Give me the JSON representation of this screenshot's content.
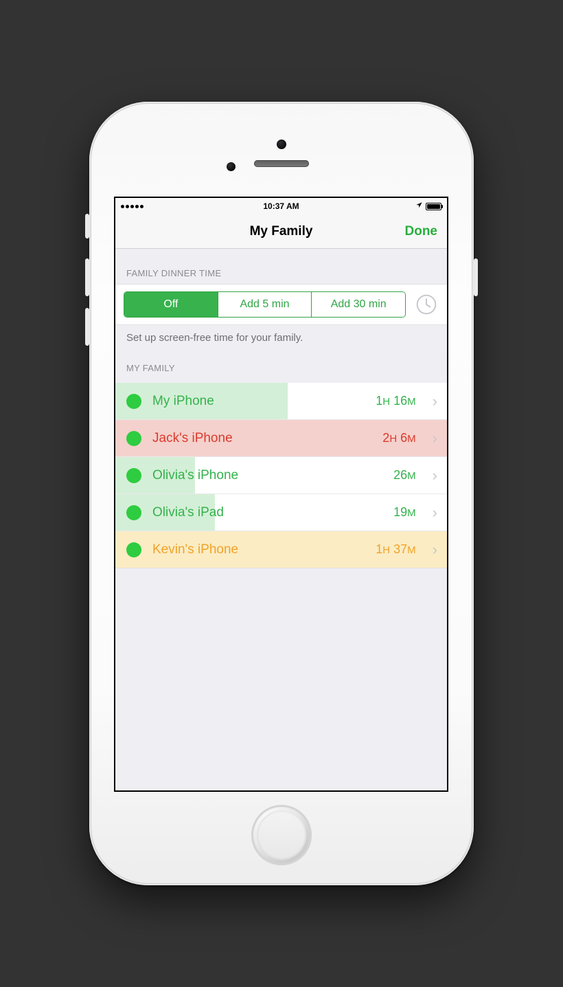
{
  "statusbar": {
    "time": "10:37 AM"
  },
  "nav": {
    "title": "My Family",
    "done": "Done"
  },
  "dinner": {
    "header": "FAMILY DINNER TIME",
    "options": [
      "Off",
      "Add 5 min",
      "Add 30 min"
    ],
    "selected_index": 0,
    "footer": "Set up screen-free time for your family."
  },
  "family": {
    "header": "MY FAMILY",
    "devices": [
      {
        "name": "My iPhone",
        "time": "1H 16M",
        "fill_pct": 52,
        "fill_color": "#d4efd7",
        "text_color": "#34b24c",
        "time_color": "#34b24c",
        "dot_color": "#2ecc40"
      },
      {
        "name": "Jack's iPhone",
        "time": "2H 6M",
        "fill_pct": 100,
        "fill_color": "#f4d1cc",
        "text_color": "#dc3a2d",
        "time_color": "#dc3a2d",
        "dot_color": "#2ecc40"
      },
      {
        "name": "Olivia's iPhone",
        "time": "26M",
        "fill_pct": 24,
        "fill_color": "#d4efd7",
        "text_color": "#34b24c",
        "time_color": "#34b24c",
        "dot_color": "#2ecc40"
      },
      {
        "name": "Olivia's iPad",
        "time": "19M",
        "fill_pct": 30,
        "fill_color": "#d4efd7",
        "text_color": "#34b24c",
        "time_color": "#34b24c",
        "dot_color": "#2ecc40"
      },
      {
        "name": "Kevin's iPhone",
        "time": "1H 37M",
        "fill_pct": 100,
        "fill_color": "#fbecc3",
        "text_color": "#f0a32a",
        "time_color": "#f0a32a",
        "dot_color": "#2ecc40"
      }
    ]
  }
}
